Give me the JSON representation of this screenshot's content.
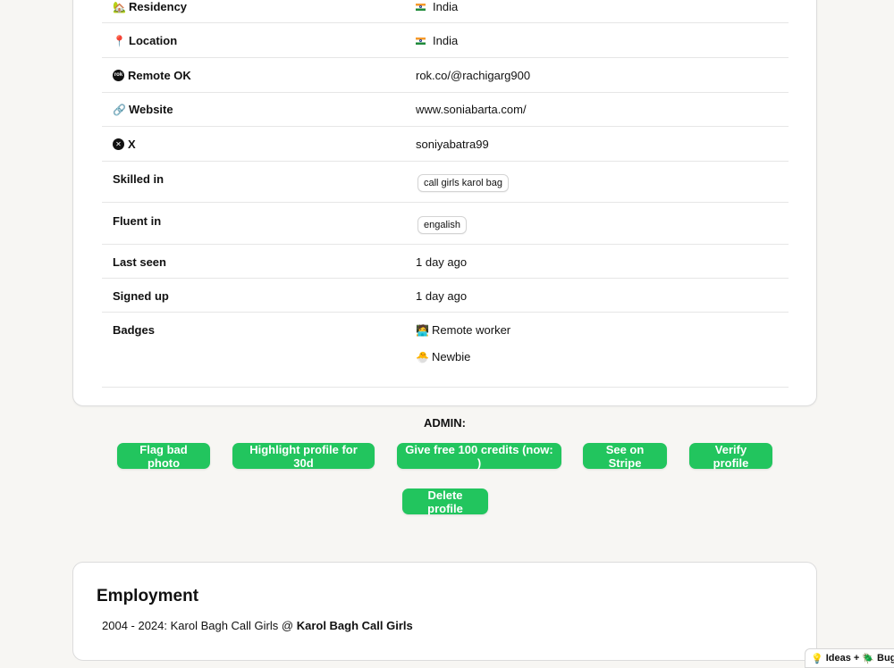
{
  "profile": {
    "rows": [
      {
        "label": "Residency",
        "icon": "house-icon",
        "value": "India",
        "value_icon": "india-flag-icon"
      },
      {
        "label": "Location",
        "icon": "pin-icon",
        "value": "India",
        "value_icon": "india-flag-icon"
      },
      {
        "label": "Remote OK",
        "icon": "remote-ok-icon",
        "value": "rok.co/@rachigarg900"
      },
      {
        "label": "Website",
        "icon": "link-icon",
        "value": "www.soniabarta.com/"
      },
      {
        "label": "X",
        "icon": "x-logo-icon",
        "value": "soniyabatra99"
      },
      {
        "label": "Skilled in",
        "tags": [
          "call girls karol bag"
        ]
      },
      {
        "label": "Fluent in",
        "tags": [
          "engalish"
        ]
      },
      {
        "label": "Last seen",
        "value": "1 day ago"
      },
      {
        "label": "Signed up",
        "value": "1 day ago"
      },
      {
        "label": "Badges",
        "badges": [
          {
            "icon": "remote-worker-icon",
            "label": "Remote worker"
          },
          {
            "icon": "newbie-chick-icon",
            "label": "Newbie"
          }
        ]
      }
    ]
  },
  "admin": {
    "title": "ADMIN:",
    "buttons": {
      "flag_bad_photo": "Flag bad photo",
      "highlight_profile": "Highlight profile for 30d",
      "give_free_credits": "Give free 100 credits (now: )",
      "see_on_stripe": "See on Stripe",
      "verify_profile": "Verify profile",
      "delete_profile": "Delete profile"
    },
    "button_color": "#22c55e"
  },
  "employment": {
    "title": "Employment",
    "entry_prefix": "2004 - 2024: Karol Bagh Call Girls @ ",
    "entry_company": "Karol Bagh Call Girls"
  },
  "feedback_widget": {
    "label": "Ideas + ",
    "label2": "Bugs",
    "icons": [
      "lightbulb-icon",
      "bug-icon"
    ]
  }
}
